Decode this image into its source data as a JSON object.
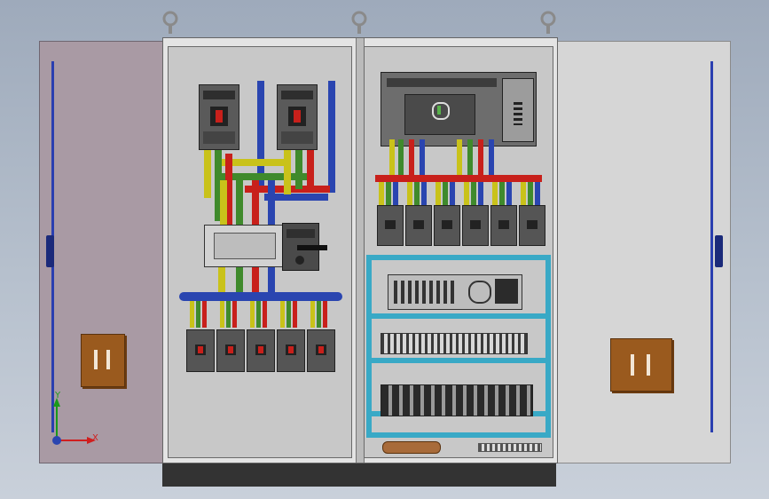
{
  "viewport": {
    "triad": {
      "x_label": "X",
      "y_label": "Y"
    }
  },
  "cabinet": {
    "colors": {
      "left_door": "#a99aa4",
      "right_door": "#d3d3d3",
      "mount_plate": "#c8c8c8",
      "plinth": "#333333",
      "bus_blue": "#2a45b0",
      "bus_red": "#c8201b",
      "bus_yellow": "#c9c21a",
      "bus_green": "#3f8a2c",
      "dinrail_cyan": "#39a9c6",
      "handle_brown": "#9a5a1e"
    },
    "main_breakers": [
      "breaker-1",
      "breaker-2"
    ],
    "left_outlet_breakers": 5,
    "right_outlet_breakers": 6
  }
}
